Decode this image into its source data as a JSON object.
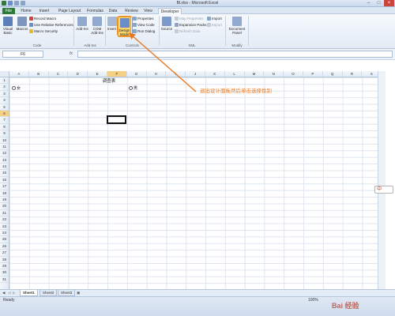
{
  "window": {
    "title": "Bl.xlsx - Microsoft Excel"
  },
  "tabs": [
    "File",
    "Home",
    "Insert",
    "Page Layout",
    "Formulas",
    "Data",
    "Review",
    "View",
    "Developer"
  ],
  "ribbon": {
    "code": {
      "label": "Code",
      "visual_basic": "Visual Basic",
      "macros": "Macros",
      "record_macro": "Record Macro",
      "relative_refs": "Use Relative References",
      "macro_security": "Macro Security"
    },
    "addins": {
      "label": "Add-Ins",
      "addins": "Add-Ins",
      "com_addins": "COM Add-Ins"
    },
    "controls": {
      "label": "Controls",
      "insert": "Insert",
      "design_mode": "Design Mode",
      "properties": "Properties",
      "view_code": "View Code",
      "run_dialog": "Run Dialog"
    },
    "xml": {
      "label": "XML",
      "source": "Source",
      "map_properties": "Map Properties",
      "expansion_packs": "Expansion Packs",
      "refresh_data": "Refresh Data",
      "import": "Import",
      "export": "Export"
    },
    "modify": {
      "label": "Modify",
      "document_panel": "Document Panel"
    }
  },
  "formula_bar": {
    "name_box": "F6",
    "fx": "fx",
    "content": ""
  },
  "grid": {
    "columns": [
      "A",
      "B",
      "C",
      "D",
      "E",
      "F",
      "G",
      "H",
      "I",
      "J",
      "K",
      "L",
      "M",
      "N",
      "O",
      "P",
      "Q",
      "R",
      "S"
    ],
    "rows": [
      "1",
      "2",
      "3",
      "4",
      "5",
      "6",
      "7",
      "8",
      "9",
      "10",
      "11",
      "12",
      "13",
      "14",
      "15",
      "16",
      "17",
      "18",
      "19",
      "20",
      "21",
      "22",
      "23",
      "24",
      "25",
      "26",
      "27",
      "28",
      "29",
      "30",
      "31"
    ],
    "selected_column": "F",
    "selected_row": "6",
    "cell_title": "调查表",
    "radio_female": "女",
    "radio_male": "男"
  },
  "annotation": {
    "text": "退出设计面板然后单击选择性别",
    "color": "#e8781f"
  },
  "sheets": [
    "Sheet1",
    "Sheet2",
    "Sheet3"
  ],
  "status": {
    "ready": "Ready",
    "zoom": "100%"
  },
  "ime": {
    "label": "中"
  },
  "watermark": "Bai 经验"
}
